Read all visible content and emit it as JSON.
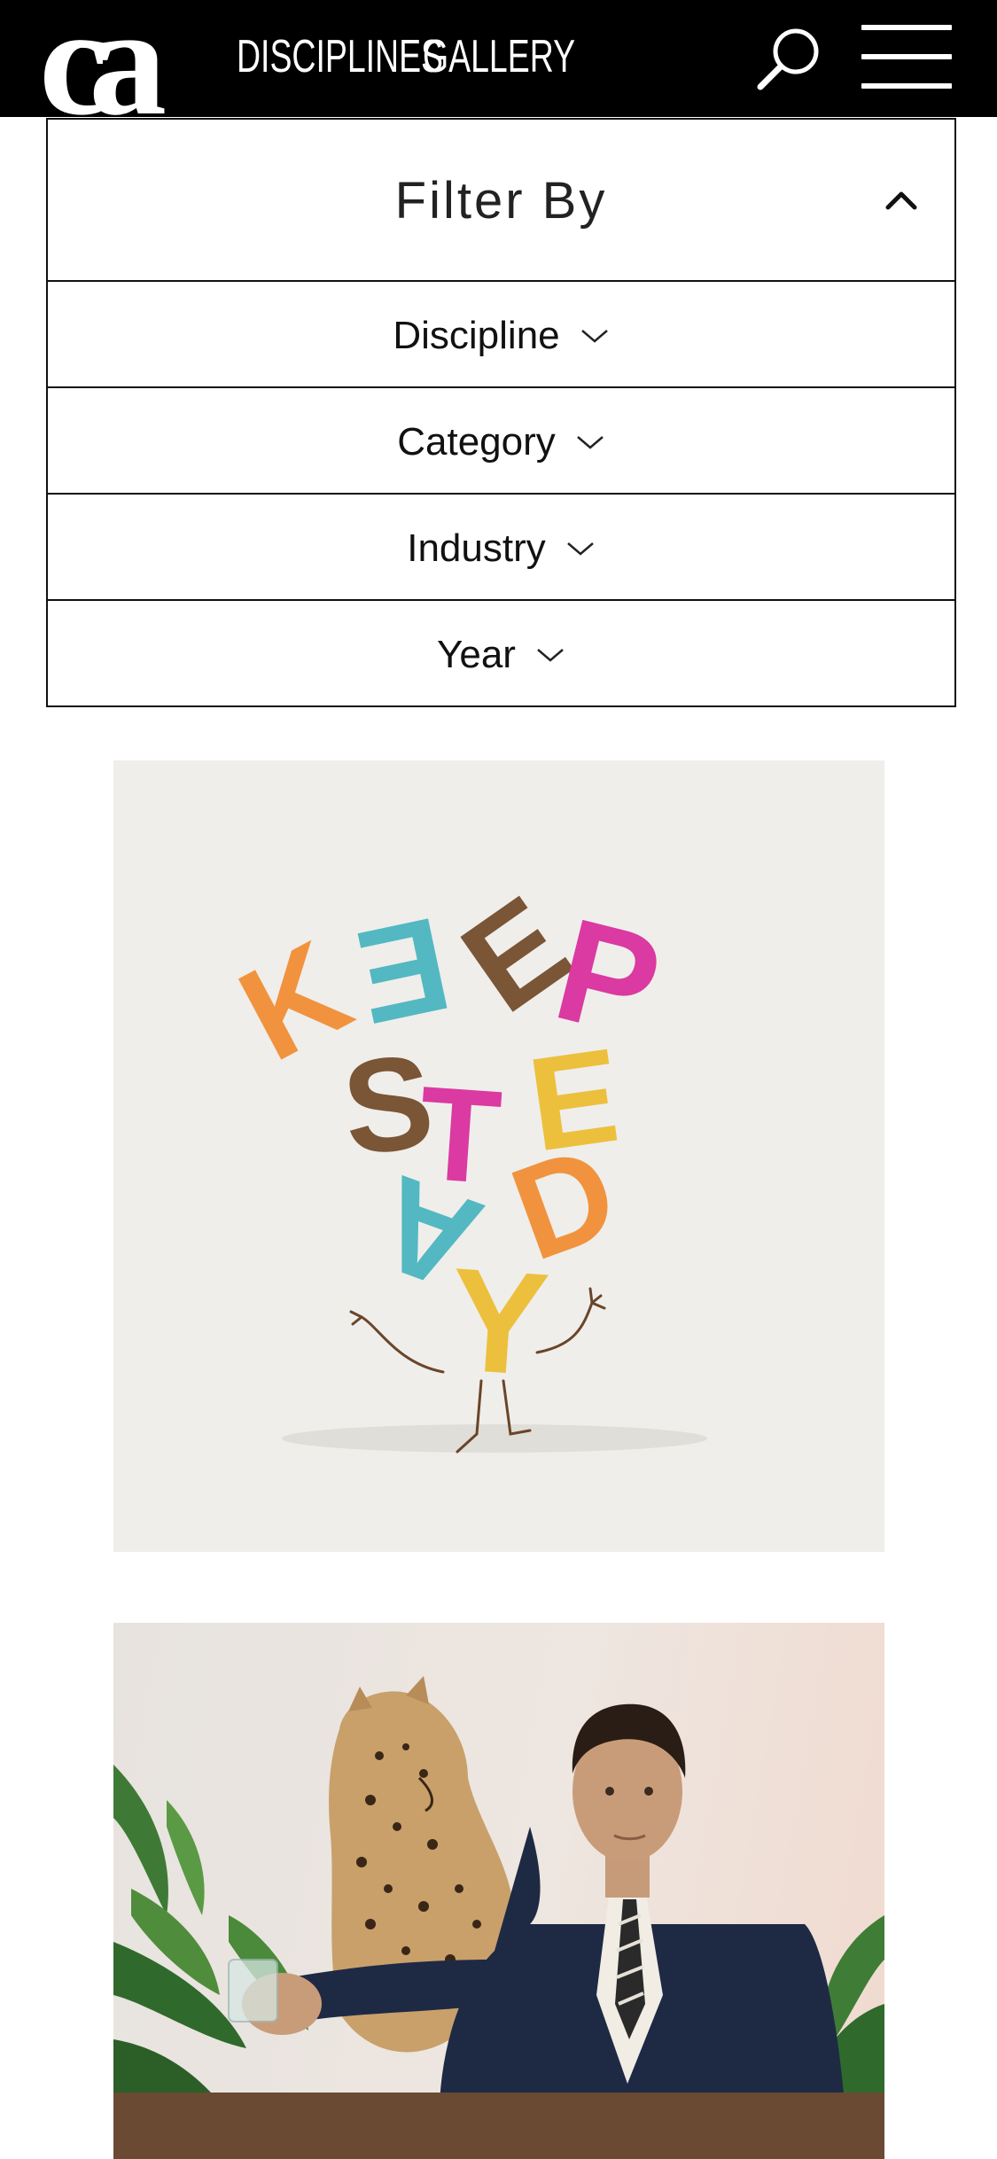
{
  "header": {
    "logo_text": "ca",
    "nav": [
      {
        "label": "DISCIPLINES"
      },
      {
        "label": "GALLERY"
      }
    ],
    "search_icon": "search-icon",
    "menu_icon": "hamburger-menu-icon"
  },
  "filter": {
    "title": "Filter By",
    "toggle_icon": "chevron-up-icon",
    "rows": [
      {
        "label": "Discipline",
        "icon": "chevron-down-icon"
      },
      {
        "label": "Category",
        "icon": "chevron-down-icon"
      },
      {
        "label": "Industry",
        "icon": "chevron-down-icon"
      },
      {
        "label": "Year",
        "icon": "chevron-down-icon"
      }
    ]
  },
  "gallery": {
    "items": [
      {
        "artwork_text": "KEEP STEADY"
      },
      {
        "artwork_text": ""
      }
    ]
  },
  "colors": {
    "header_bg": "#000000",
    "header_text": "#ffffff",
    "border": "#111111",
    "item1_bg": "#efeeeb",
    "letter_orange": "#f28a2c",
    "letter_teal": "#43b3bd",
    "letter_brown": "#6e4523",
    "letter_magenta": "#d8279a",
    "letter_yellow": "#ecbc2a"
  }
}
